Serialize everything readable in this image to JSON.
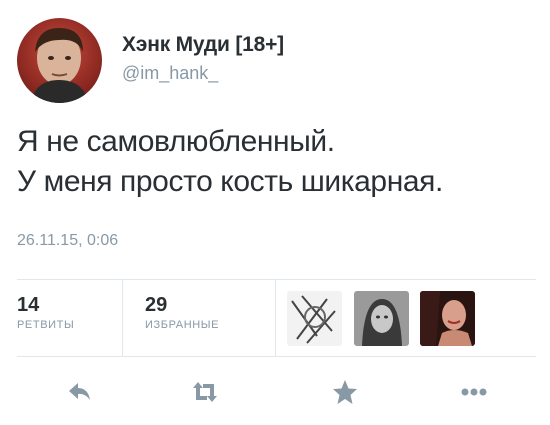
{
  "tweet": {
    "author_name": "Хэнк Муди [18+]",
    "author_handle": "@im_hank_",
    "text_lines": [
      "Я не самовлюбленный.",
      "У меня просто кость шикарная."
    ],
    "timestamp": "26.11.15, 0:06"
  },
  "stats": {
    "retweets_count": "14",
    "retweets_label": "РЕТВИТЫ",
    "favorites_count": "29",
    "favorites_label": "ИЗБРАННЫЕ"
  },
  "actions": [
    {
      "icon": "reply-icon"
    },
    {
      "icon": "retweet-icon"
    },
    {
      "icon": "star-icon"
    },
    {
      "icon": "more-icon"
    }
  ],
  "colors": {
    "text": "#292f33",
    "secondary": "#8899a6",
    "divider": "#e1e8ed",
    "action_icon": "#8899a6"
  }
}
